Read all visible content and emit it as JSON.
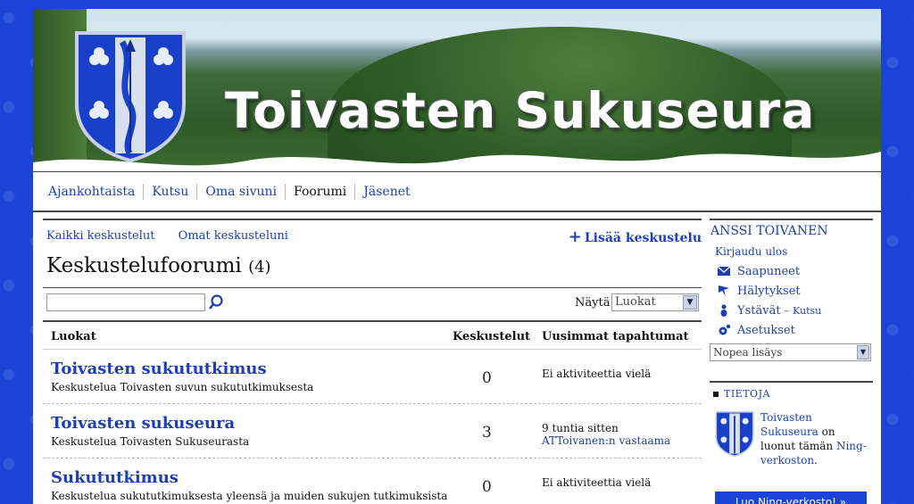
{
  "site": {
    "title": "Toivasten Sukuseura"
  },
  "nav": {
    "items": [
      {
        "label": "Ajankohtaista",
        "active": false
      },
      {
        "label": "Kutsu",
        "active": false
      },
      {
        "label": "Oma sivuni",
        "active": false
      },
      {
        "label": "Foorumi",
        "active": true
      },
      {
        "label": "Jäsenet",
        "active": false
      }
    ]
  },
  "forum": {
    "sublinks": [
      "Kaikki keskustelut",
      "Omat keskusteluni"
    ],
    "add_label": "Lisää keskustelu",
    "heading": "Keskustelufoorumi",
    "count": "(4)",
    "search": {
      "value": "",
      "placeholder": ""
    },
    "show_label": "Näytä",
    "show_value": "Luokat",
    "columns": [
      "Luokat",
      "Keskustelut",
      "Uusimmat tapahtumat"
    ],
    "rows": [
      {
        "title": "Toivasten sukututkimus",
        "desc": "Keskustelua Toivasten suvun sukututkimuksesta",
        "count": "0",
        "activity": "Ei aktiviteettia vielä",
        "activity_link": ""
      },
      {
        "title": "Toivasten sukuseura",
        "desc": "Keskustelua Toivasten Sukuseurasta",
        "count": "3",
        "activity": "9 tuntia sitten",
        "activity_link": "ATToivanen:n vastaama"
      },
      {
        "title": "Sukututkimus",
        "desc": "Keskustelua sukututkimuksesta yleensä ja muiden sukujen tutkimuksista",
        "count": "0",
        "activity": "Ei aktiviteettia vielä",
        "activity_link": ""
      }
    ]
  },
  "sidebar": {
    "user": "ANSSI TOIVANEN",
    "logout": "Kirjaudu ulos",
    "menu": {
      "inbox": "Saapuneet",
      "alerts": "Hälytykset",
      "friends": "Ystävät",
      "friends_sep": "–",
      "invite": "Kutsu",
      "settings": "Asetukset"
    },
    "quick_add": "Nopea lisäys",
    "info_heading": "TIETOJA",
    "info": {
      "link1": "Toivasten Sukuseura",
      "text1": "on luonut tämän",
      "link2": "Ning-verkoston",
      "text2": "."
    },
    "create_button": "Luo Ning-verkosto! »"
  },
  "colors": {
    "link": "#1c3fb4",
    "page_bg": "#1a44d8"
  },
  "icons": [
    "search-icon",
    "plus-icon",
    "mail-icon",
    "alert-flag-icon",
    "person-icon",
    "gear-icon",
    "chevron-down-icon",
    "coat-of-arms-icon"
  ]
}
